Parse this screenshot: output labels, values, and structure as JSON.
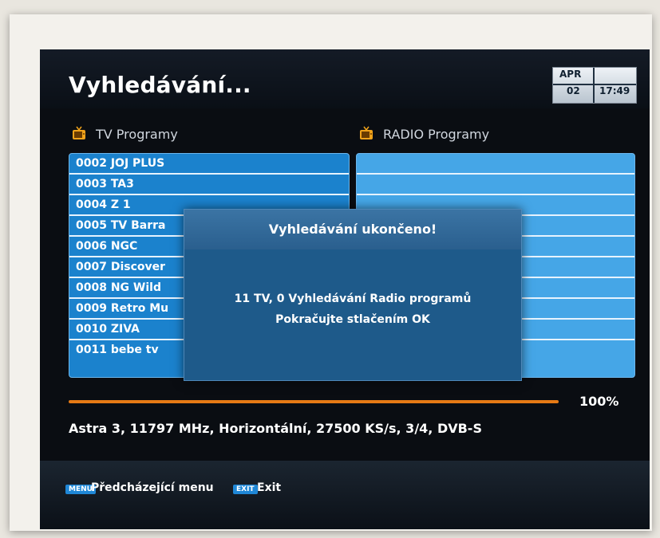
{
  "header": {
    "title": "Vyhledávání...",
    "date_month": "APR",
    "date_day": "02",
    "time": "17:49"
  },
  "tv_section": {
    "label": "TV Programy",
    "icon": "tv-icon",
    "items": [
      "0002 JOJ PLUS",
      "0003 TA3",
      "0004 Z 1",
      "0005 TV Barra",
      "0006 NGC",
      "0007 Discover",
      "0008 NG Wild",
      "0009 Retro Mu",
      "0010 ZIVA",
      "0011 bebe tv"
    ]
  },
  "radio_section": {
    "label": "RADIO Programy",
    "icon": "tv-icon",
    "items": []
  },
  "dialog": {
    "title": "Vyhledávání ukončeno!",
    "message": "11 TV, 0 Vyhledávání Radio programů",
    "instruction": "Pokračujte stlačením OK"
  },
  "progress": {
    "percent_label": "100%",
    "value": 1.0,
    "color": "#e67a15"
  },
  "transponder": "Astra 3, 11797 MHz, Horizontální, 27500 KS/s, 3/4, DVB-S",
  "footer": {
    "menu_key": "MENU",
    "menu_label": "Předcházející menu",
    "exit_key": "EXIT",
    "exit_label": "Exit"
  },
  "colors": {
    "list_blue": "#1b82cd",
    "dialog_blue": "#1e5a8a",
    "accent_orange": "#e67a15"
  }
}
